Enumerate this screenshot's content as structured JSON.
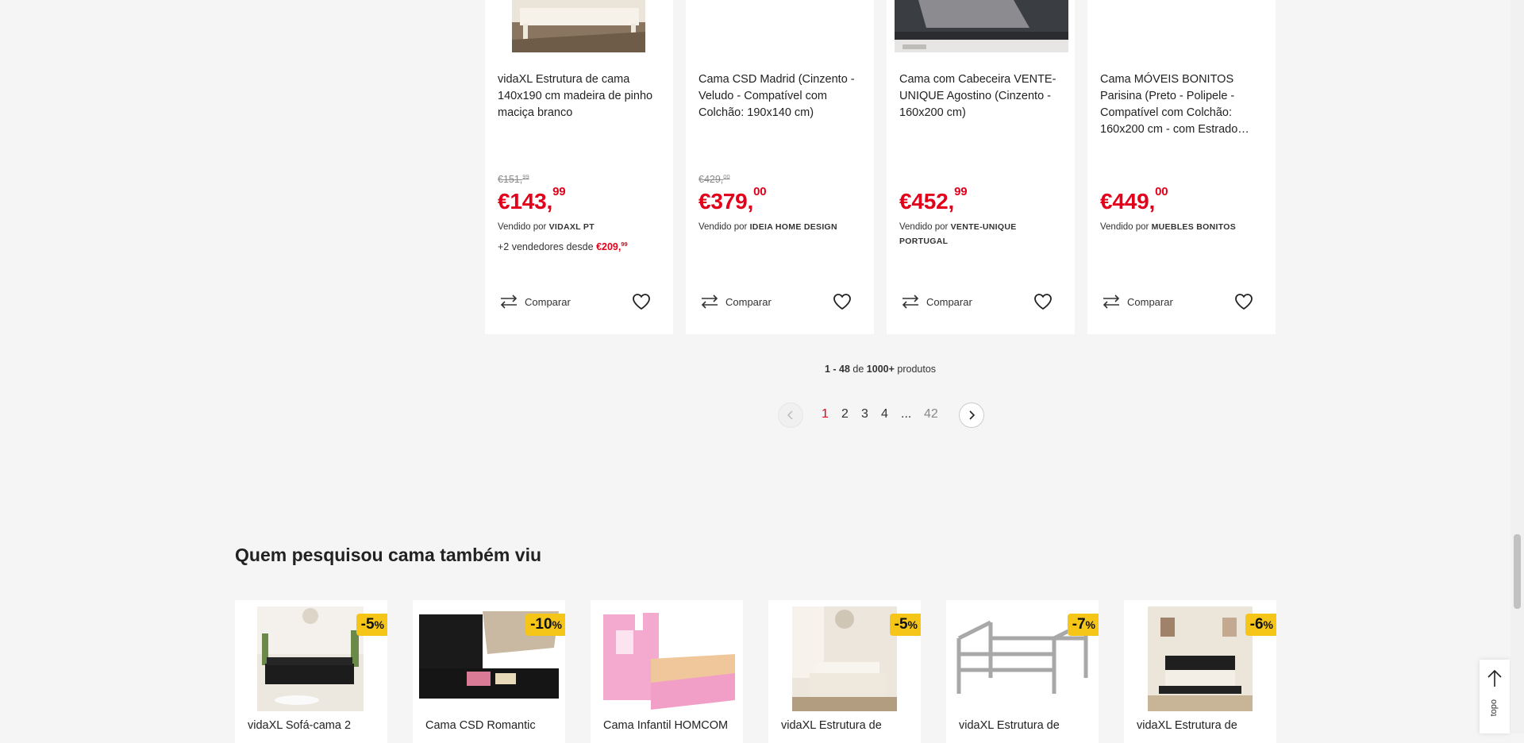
{
  "products": [
    {
      "title": "vidaXL Estrutura de cama 140x190 cm madeira de pinho maciça branco",
      "old_price_main": "€151,",
      "old_price_cents": "99",
      "price_main": "€143,",
      "price_cents": "99",
      "sold_by_label": "Vendido por",
      "seller": "VIDAXL PT",
      "others_text": "+2 vendedores desde",
      "others_price_main": "€209,",
      "others_price_cents": "99",
      "compare_label": "Comparar"
    },
    {
      "title": "Cama CSD Madrid (Cinzento - Veludo - Compatível com Colchão: 190x140 cm)",
      "old_price_main": "€429,",
      "old_price_cents": "00",
      "price_main": "€379,",
      "price_cents": "00",
      "sold_by_label": "Vendido por",
      "seller": "IDEIA HOME DESIGN",
      "compare_label": "Comparar"
    },
    {
      "title": "Cama com Cabeceira VENTE-UNIQUE Agostino (Cinzento - 160x200 cm)",
      "price_main": "€452,",
      "price_cents": "99",
      "sold_by_label": "Vendido por",
      "seller": "VENTE-UNIQUE PORTUGAL",
      "compare_label": "Comparar"
    },
    {
      "title": "Cama MÓVEIS BONITOS Parisina (Preto - Polipele - Compatível com Colchão: 160x200 cm - com Estrado…",
      "price_main": "€449,",
      "price_cents": "00",
      "sold_by_label": "Vendido por",
      "seller": "MUEBLES BONITOS",
      "compare_label": "Comparar"
    }
  ],
  "results": {
    "range_start": "1",
    "range_sep": " - ",
    "range_end": "48",
    "of_label": " de ",
    "total": "1000+",
    "unit_label": " produtos"
  },
  "pagination": {
    "pages": [
      "1",
      "2",
      "3",
      "4"
    ],
    "ellipsis": "...",
    "last": "42",
    "current": "1"
  },
  "related": {
    "title": "Quem pesquisou cama também viu",
    "items": [
      {
        "title": "vidaXL Sofá-cama 2",
        "discount": "-5",
        "pct": "%"
      },
      {
        "title": "Cama CSD Romantic",
        "discount": "-10",
        "pct": "%"
      },
      {
        "title": "Cama Infantil HOMCOM",
        "discount": "",
        "pct": ""
      },
      {
        "title": "vidaXL Estrutura de",
        "discount": "-5",
        "pct": "%"
      },
      {
        "title": "vidaXL Estrutura de",
        "discount": "-7",
        "pct": "%"
      },
      {
        "title": "vidaXL Estrutura de",
        "discount": "-6",
        "pct": "%"
      }
    ]
  },
  "back_to_top": {
    "label": "topo"
  },
  "colors": {
    "price_red": "#e2001a",
    "badge_yellow": "#f5c518",
    "page_bg": "#f5f5f5"
  }
}
